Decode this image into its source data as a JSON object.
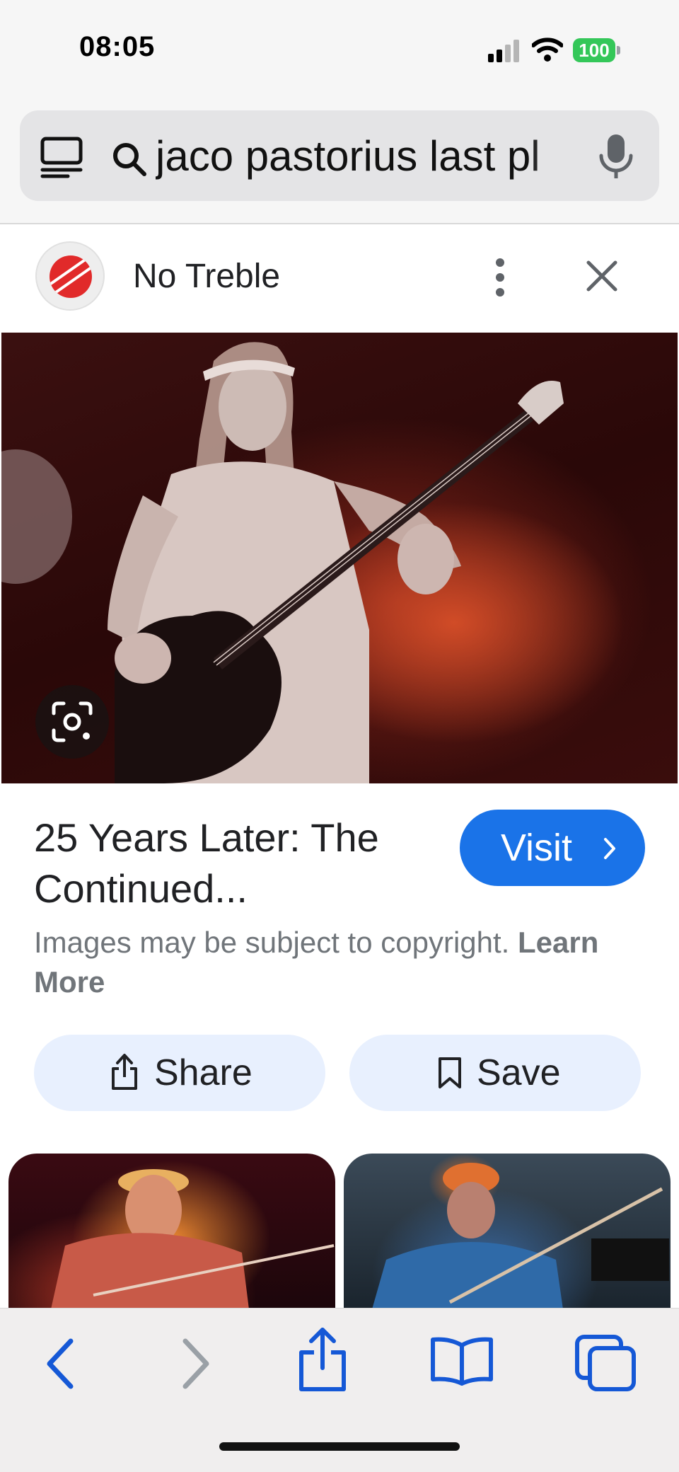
{
  "status_bar": {
    "time": "08:05",
    "battery": "100",
    "icons": [
      "signal-icon",
      "wifi-icon",
      "battery-icon"
    ]
  },
  "address_bar": {
    "query": "jaco pastorius last pl",
    "icons": [
      "tabs-overview-icon",
      "search-icon",
      "microphone-icon"
    ]
  },
  "source": {
    "name": "No Treble",
    "icons": [
      "more-options-icon",
      "close-icon"
    ]
  },
  "image_viewer": {
    "lens_icon": "lens-search-icon"
  },
  "result": {
    "title": "25 Years Later: The Continued...",
    "visit_label": "Visit",
    "copyright_text": "Images may be subject to copyright.",
    "learn_more": "Learn More"
  },
  "actions": {
    "share_label": "Share",
    "save_label": "Save"
  },
  "toolbar": {
    "icons": [
      "back-icon",
      "forward-icon",
      "share-icon",
      "bookmarks-icon",
      "tabs-icon"
    ]
  },
  "colors": {
    "accent": "#1a73e8",
    "toolbar_icon": "#1558d6",
    "battery": "#34c759"
  }
}
